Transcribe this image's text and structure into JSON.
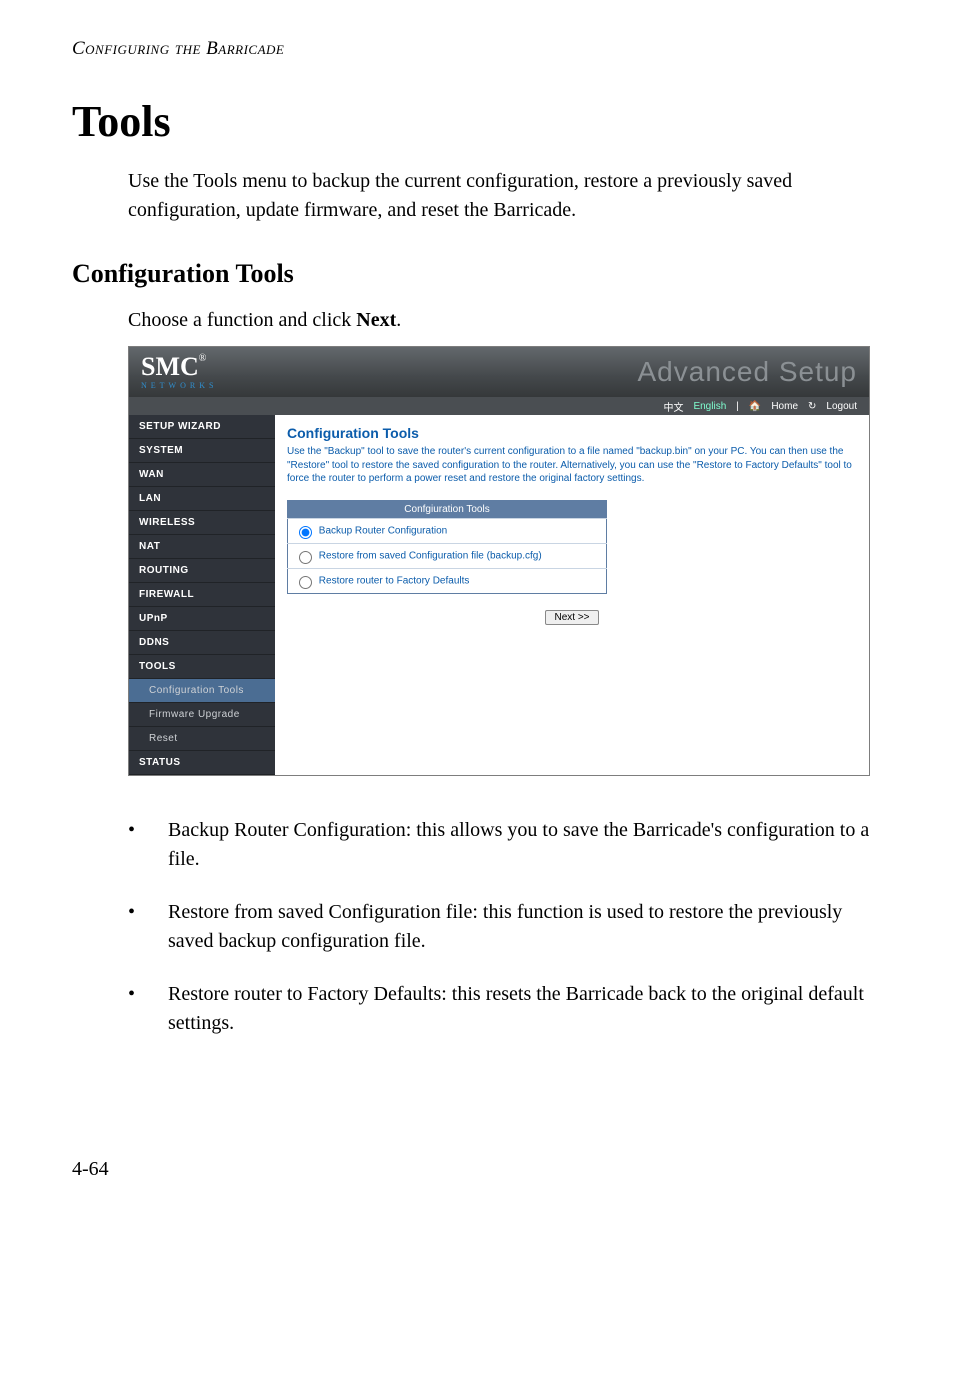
{
  "running_head": "Configuring the Barricade",
  "title": "Tools",
  "intro": "Use the Tools menu to backup the current configuration, restore a previously saved configuration, update firmware, and reset the Barricade.",
  "subhead": "Configuration Tools",
  "subintro_prefix": "Choose a function and click ",
  "subintro_bold": "Next",
  "subintro_suffix": ".",
  "screenshot": {
    "logo_main": "SMC",
    "logo_reg": "®",
    "logo_sub": "Networks",
    "brand_right": "Advanced Setup",
    "subbar": {
      "lang_cn": "中文",
      "lang_en": "English",
      "home": "Home",
      "logout": "Logout"
    },
    "nav": [
      {
        "label": "SETUP WIZARD",
        "level": 1
      },
      {
        "label": "SYSTEM",
        "level": 1
      },
      {
        "label": "WAN",
        "level": 1
      },
      {
        "label": "LAN",
        "level": 1
      },
      {
        "label": "WIRELESS",
        "level": 1
      },
      {
        "label": "NAT",
        "level": 1
      },
      {
        "label": "ROUTING",
        "level": 1
      },
      {
        "label": "FIREWALL",
        "level": 1
      },
      {
        "label": "UPnP",
        "level": 1
      },
      {
        "label": "DDNS",
        "level": 1
      },
      {
        "label": "TOOLS",
        "level": 1
      },
      {
        "label": "Configuration Tools",
        "level": 2,
        "active": true
      },
      {
        "label": "Firmware Upgrade",
        "level": 2
      },
      {
        "label": "Reset",
        "level": 2
      },
      {
        "label": "STATUS",
        "level": 1
      }
    ],
    "main": {
      "heading": "Configuration Tools",
      "desc": "Use the \"Backup\" tool to save the router's current configuration to a file named \"backup.bin\" on your PC. You can then use the \"Restore\" tool to restore the saved configuration to the router. Alternatively, you can use the \"Restore to Factory Defaults\" tool to force the router to perform a power reset and restore the original factory settings.",
      "table_header": "Confgiuration Tools",
      "options": [
        {
          "label": "Backup Router Configuration",
          "checked": true
        },
        {
          "label": "Restore from saved Configuration file (backup.cfg)",
          "checked": false
        },
        {
          "label": "Restore router to Factory Defaults",
          "checked": false
        }
      ],
      "next_label": "Next >>"
    }
  },
  "bullets": [
    "Backup Router Configuration: this allows you to save the Barricade's configuration to a file.",
    "Restore from saved Configuration file: this function is used to restore the previously saved backup configuration file.",
    "Restore router to Factory Defaults: this resets the Barricade back to the original default settings."
  ],
  "page_number": "4-64"
}
